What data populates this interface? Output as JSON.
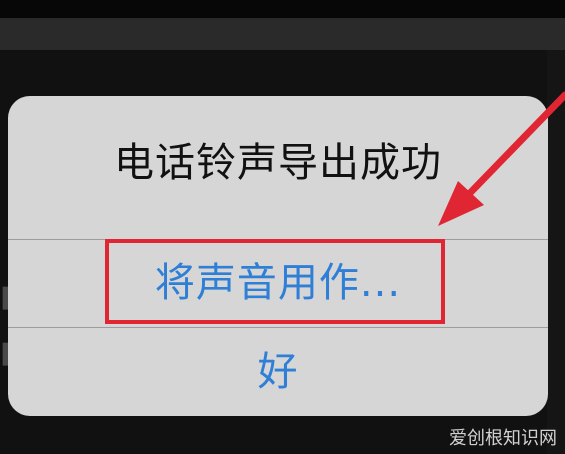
{
  "dialog": {
    "title": "电话铃声导出成功",
    "primary_action": "将声音用作...",
    "ok_action": "好"
  },
  "annotation": {
    "color": "#e02533"
  },
  "watermark": {
    "text": "爱创根知识网"
  },
  "colors": {
    "dialog_background": "#d6d6d6",
    "action_blue": "#2f7fd6",
    "title_text": "#111111"
  }
}
